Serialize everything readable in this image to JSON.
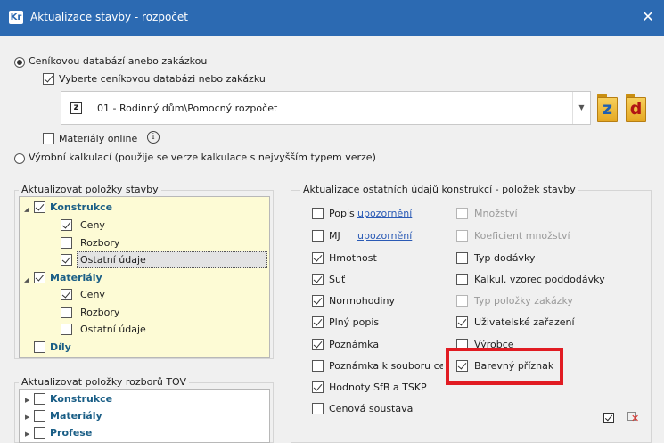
{
  "window": {
    "app_badge": "Kr",
    "title": "Aktualizace stavby - rozpočet",
    "close_glyph": "✕"
  },
  "source": {
    "radio_database": "Ceníkovou databází anebo zakázkou",
    "checkbox_select": "Vyberte ceníkovou databázi nebo zakázku",
    "combo_icon_letter": "z",
    "combo_value": "01 - Rodinný dům\\Pomocný rozpočet",
    "folder_z_letter": "z",
    "folder_d_letter": "d",
    "materials_online": "Materiály online",
    "info_glyph": "i",
    "radio_production": "Výrobní kalkulací (použije se verze kalkulace s nejvyšším typem verze)"
  },
  "update_items": {
    "title": "Aktualizovat položky stavby",
    "konstrukce": "Konstrukce",
    "ceny": "Ceny",
    "rozbory": "Rozbory",
    "ostatni": "Ostatní údaje",
    "materialy": "Materiály",
    "ceny2": "Ceny",
    "rozbory2": "Rozbory",
    "ostatni2": "Ostatní údaje",
    "dily": "Díly"
  },
  "update_tov": {
    "title": "Aktualizovat položky rozborů TOV",
    "konstrukce": "Konstrukce",
    "materialy": "Materiály",
    "profese": "Profese"
  },
  "other_data": {
    "title": "Aktualizace ostatních údajů konstrukcí - položek stavby",
    "left": {
      "popis": "Popis",
      "popis_link": "upozornění",
      "mj": "MJ",
      "mj_link": "upozornění",
      "hmotnost": "Hmotnost",
      "sut": "Suť",
      "normohodiny": "Normohodiny",
      "plny_popis": "Plný popis",
      "poznamka": "Poznámka",
      "poznamka_soubor": "Poznámka k souboru cen",
      "hodnoty": "Hodnoty SfB a TSKP",
      "cenova": "Cenová soustava"
    },
    "right": {
      "mnozstvi": "Množství",
      "koeficient": "Koeficient množství",
      "typ_dodavky": "Typ dodávky",
      "kalkul": "Kalkul. vzorec poddodávky",
      "typ_polozky": "Typ položky zakázky",
      "uzivatelske": "Uživatelské zařazení",
      "vyrobce": "Výrobce",
      "barevny": "Barevný příznak"
    }
  },
  "colors": {
    "titlebar": "#2c6ab2",
    "tree_highlight": "#fdfbd5",
    "tree_node_text": "#1a5e86",
    "link": "#2a5ab5",
    "highlight_box": "#e11b22"
  }
}
